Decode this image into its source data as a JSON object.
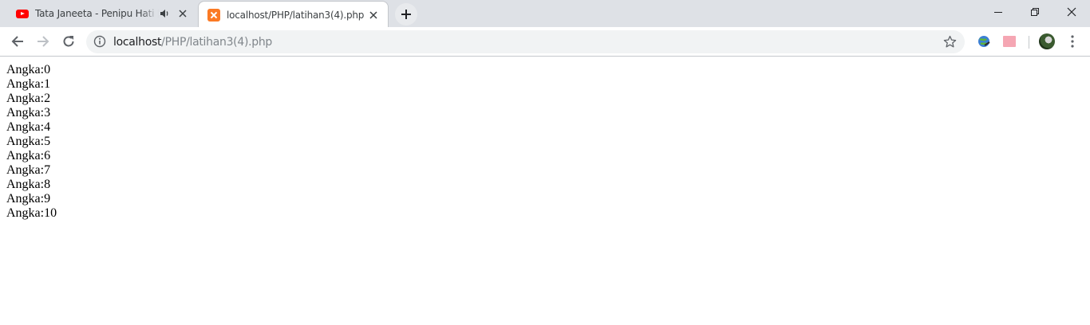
{
  "tabs": [
    {
      "title": "Tata Janeeta - Penipu Hati [Official",
      "favicon": "youtube-icon",
      "audio": true
    },
    {
      "title": "localhost/PHP/latihan3(4).php",
      "favicon": "xampp-icon",
      "active": true
    }
  ],
  "omnibox": {
    "host": "localhost",
    "path": "/PHP/latihan3(4).php"
  },
  "window_controls": [
    "minimize",
    "restore",
    "close"
  ],
  "page": {
    "lines": [
      "Angka:0",
      "Angka:1",
      "Angka:2",
      "Angka:3",
      "Angka:4",
      "Angka:5",
      "Angka:6",
      "Angka:7",
      "Angka:8",
      "Angka:9",
      "Angka:10"
    ]
  },
  "colors": {
    "tabstrip": "#dee1e6",
    "youtube_red": "#ff0000",
    "xampp_orange": "#fb7a24"
  }
}
